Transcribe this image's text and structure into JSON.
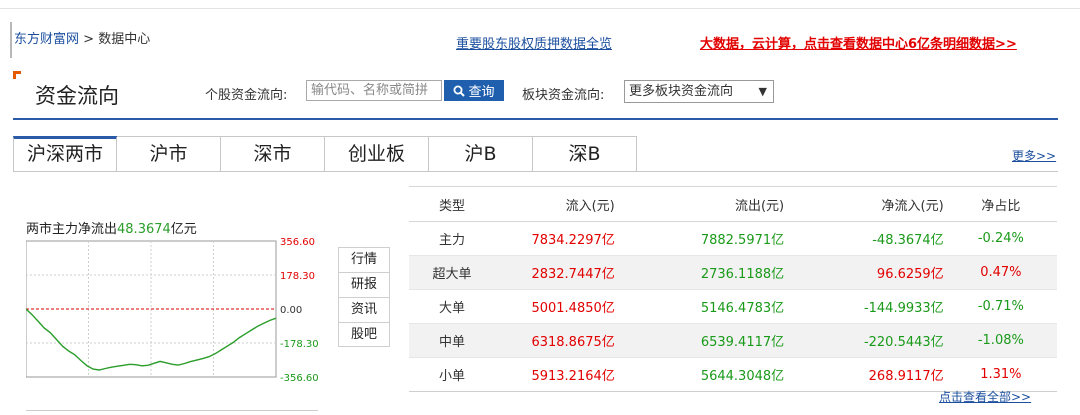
{
  "breadcrumb": {
    "site": "东方财富网",
    "separator": ">",
    "page": "数据中心"
  },
  "header": {
    "mid_link": "重要股东股权质押数据全览",
    "promo_link": "大数据，云计算，点击查看数据中心6亿条明细数据>>"
  },
  "section": {
    "title": "资金流向"
  },
  "search": {
    "label": "个股资金流向:",
    "placeholder": "输代码、名称或简拼",
    "button": "查询",
    "button_icon": "search-icon"
  },
  "sector": {
    "label": "板块资金流向:",
    "selected": "更多板块资金流向"
  },
  "tabs": [
    "沪深两市",
    "沪市",
    "深市",
    "创业板",
    "沪B",
    "深B"
  ],
  "more_link": "更多>>",
  "chart": {
    "title_prefix": "两市主力净流出",
    "title_value": "48.3674",
    "title_unit": "亿元",
    "ticks": [
      "356.60",
      "178.30",
      "0.00",
      "-178.30",
      "-356.60"
    ]
  },
  "chart_data": {
    "type": "line",
    "title": "两市主力净流出48.3674亿元",
    "ylim": [
      -356.6,
      356.6
    ],
    "yticks": [
      356.6,
      178.3,
      0,
      -178.3,
      -356.6
    ],
    "series": [
      {
        "values": [
          0,
          -30,
          -65,
          -100,
          -125,
          -160,
          -195,
          -220,
          -240,
          -270,
          -298,
          -315,
          -320,
          -312,
          -305,
          -300,
          -295,
          -290,
          -292,
          -298,
          -295,
          -285,
          -275,
          -282,
          -290,
          -294,
          -286,
          -276,
          -268,
          -260,
          -250,
          -235,
          -215,
          -195,
          -175,
          -150,
          -130,
          -110,
          -90,
          -75,
          -60,
          -48
        ]
      }
    ],
    "zero_line": true,
    "grid": true
  },
  "side_buttons": [
    "行情",
    "研报",
    "资讯",
    "股吧"
  ],
  "table": {
    "headers": [
      "类型",
      "流入(元)",
      "流出(元)",
      "净流入(元)",
      "净占比"
    ],
    "rows": [
      {
        "type": "主力",
        "inflow": "7834.2297亿",
        "outflow": "7882.5971亿",
        "net": "-48.3674亿",
        "ratio": "-0.24%",
        "net_color": "green"
      },
      {
        "type": "超大单",
        "inflow": "2832.7447亿",
        "outflow": "2736.1188亿",
        "net": "96.6259亿",
        "ratio": "0.47%",
        "net_color": "red"
      },
      {
        "type": "大单",
        "inflow": "5001.4850亿",
        "outflow": "5146.4783亿",
        "net": "-144.9933亿",
        "ratio": "-0.71%",
        "net_color": "green"
      },
      {
        "type": "中单",
        "inflow": "6318.8675亿",
        "outflow": "6539.4117亿",
        "net": "-220.5443亿",
        "ratio": "-1.08%",
        "net_color": "green"
      },
      {
        "type": "小单",
        "inflow": "5913.2164亿",
        "outflow": "5644.3048亿",
        "net": "268.9117亿",
        "ratio": "1.31%",
        "net_color": "red"
      }
    ]
  },
  "view_all": "点击查看全部>>",
  "colors": {
    "accent": "#2b5aa8",
    "up": "#e20000",
    "down": "#1a9a1a",
    "corner": "#e45a00"
  }
}
